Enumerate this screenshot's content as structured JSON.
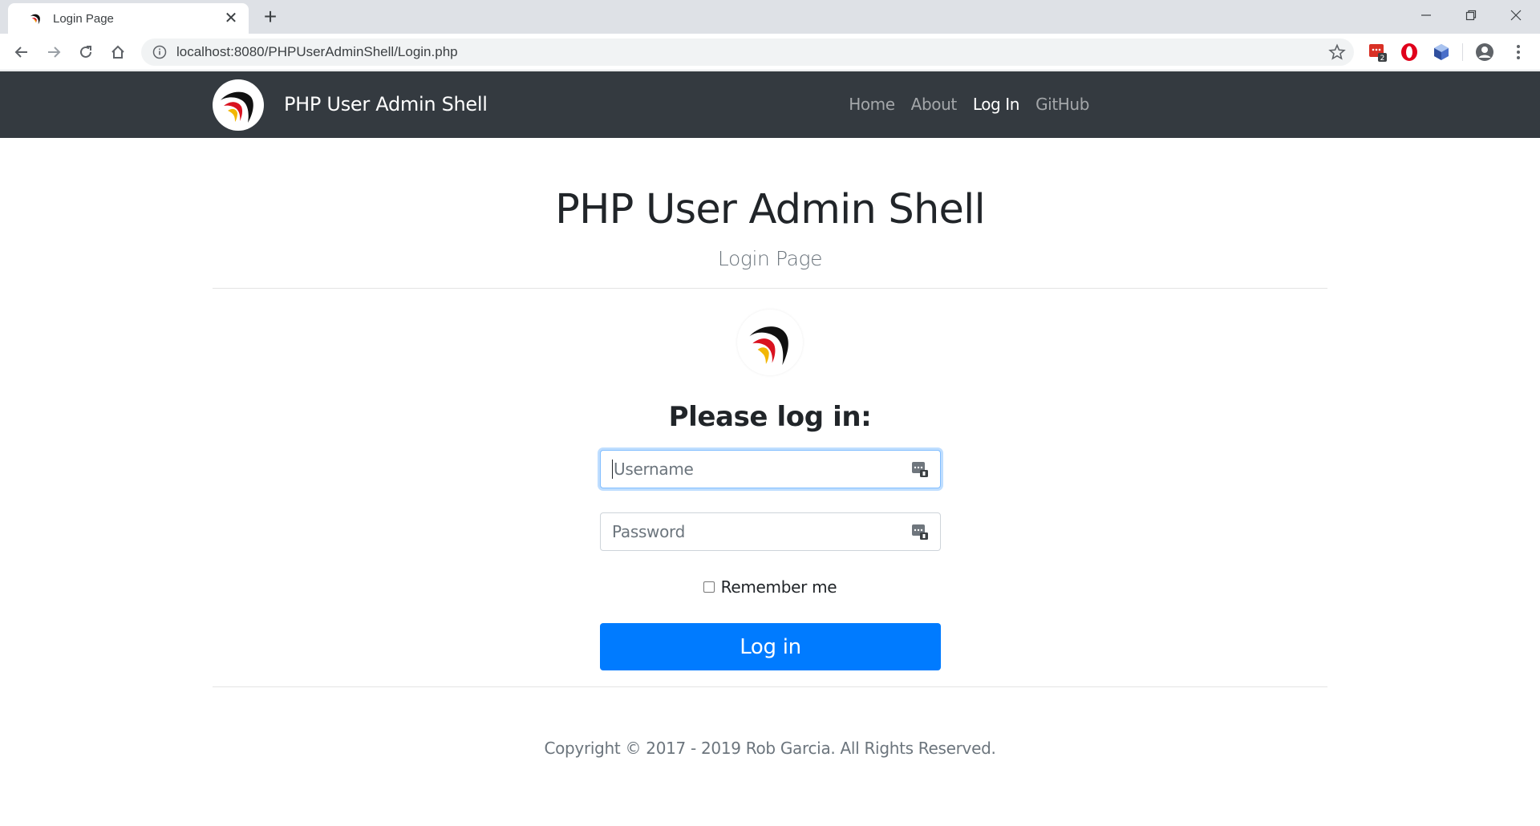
{
  "browser": {
    "tab_title": "Login Page",
    "tab_close": "✕",
    "new_tab": "+",
    "url": "localhost:8080/PHPUserAdminShell/Login.php",
    "extension_badge": "2",
    "icons": [
      "back-arrow",
      "forward-arrow",
      "reload",
      "home",
      "info",
      "star",
      "extension-pw",
      "extension-opera",
      "extension-cube",
      "profile",
      "menu-dots",
      "minimize",
      "restore",
      "close-window"
    ]
  },
  "navbar": {
    "brand": "PHP User Admin Shell",
    "links": [
      {
        "label": "Home",
        "active": false
      },
      {
        "label": "About",
        "active": false
      },
      {
        "label": "Log In",
        "active": true
      },
      {
        "label": "GitHub",
        "active": false
      }
    ]
  },
  "main": {
    "title": "PHP User Admin Shell",
    "subtitle": "Login Page",
    "form_heading": "Please log in:",
    "username_placeholder": "Username",
    "password_placeholder": "Password",
    "remember_label": "Remember me",
    "submit_label": "Log in"
  },
  "footer": {
    "copyright": "Copyright © 2017 - 2019 Rob Garcia. All Rights Reserved."
  },
  "colors": {
    "navbar_bg": "#343a40",
    "primary": "#007bff",
    "text": "#212529",
    "muted": "#6c757d"
  }
}
